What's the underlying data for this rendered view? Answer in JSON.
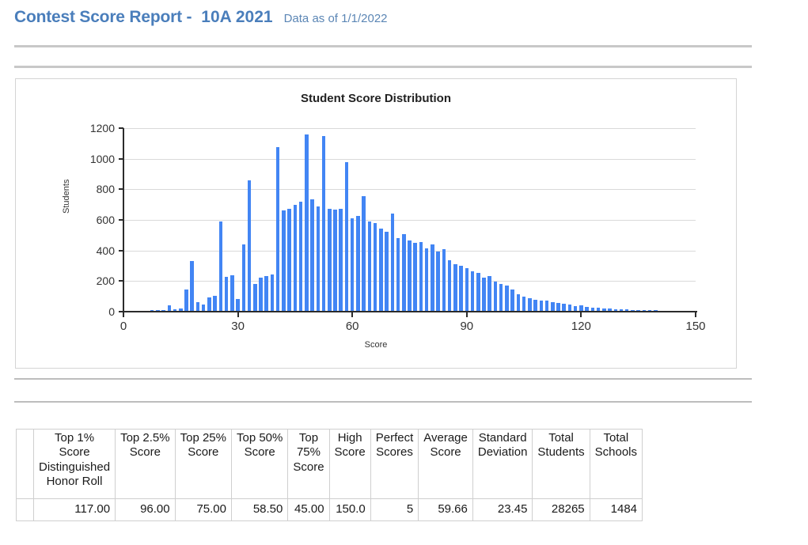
{
  "header": {
    "title": "Contest Score Report -",
    "contest": "10A 2021",
    "as_of": "Data as of 1/1/2022",
    "title_color": "#4a7ebb",
    "asof_color": "#5b86b5"
  },
  "chart_data": {
    "type": "bar",
    "title": "Student Score Distribution",
    "xlabel": "Score",
    "ylabel": "Students",
    "xlim": [
      0,
      150
    ],
    "ylim": [
      0,
      1200
    ],
    "ytick_step": 200,
    "yticks": [
      0,
      200,
      400,
      600,
      800,
      1000,
      1200
    ],
    "xticks": [
      0,
      30,
      60,
      90,
      120,
      150
    ],
    "grid": true,
    "legend": "none",
    "bar_color": "#4285f4",
    "bin_width": 1.5,
    "x": [
      0,
      1.5,
      3,
      4.5,
      6,
      7.5,
      9,
      10.5,
      12,
      13.5,
      15,
      16.5,
      18,
      19.5,
      21,
      22.5,
      24,
      25.5,
      27,
      28.5,
      30,
      31.5,
      33,
      34.5,
      36,
      37.5,
      39,
      40.5,
      42,
      43.5,
      45,
      46.5,
      48,
      49.5,
      51,
      52.5,
      54,
      55.5,
      57,
      58.5,
      60,
      61.5,
      63,
      64.5,
      66,
      67.5,
      69,
      70.5,
      72,
      73.5,
      75,
      76.5,
      78,
      79.5,
      81,
      82.5,
      84,
      85.5,
      87,
      88.5,
      90,
      91.5,
      93,
      94.5,
      96,
      97.5,
      99,
      100.5,
      102,
      103.5,
      105,
      106.5,
      108,
      109.5,
      111,
      112.5,
      114,
      115.5,
      117,
      118.5,
      120,
      121.5,
      123,
      124.5,
      126,
      127.5,
      129,
      130.5,
      132,
      133.5,
      135,
      136.5,
      138,
      139.5,
      141,
      142.5,
      144,
      145.5,
      147,
      148.5,
      150
    ],
    "values": [
      2,
      4,
      3,
      5,
      6,
      8,
      10,
      12,
      40,
      18,
      22,
      145,
      330,
      60,
      45,
      95,
      105,
      590,
      230,
      240,
      85,
      440,
      860,
      180,
      220,
      235,
      245,
      1075,
      660,
      675,
      700,
      720,
      1160,
      735,
      690,
      1150,
      670,
      665,
      675,
      980,
      610,
      625,
      755,
      590,
      580,
      545,
      520,
      640,
      480,
      505,
      465,
      450,
      455,
      415,
      440,
      395,
      410,
      335,
      310,
      300,
      285,
      265,
      255,
      225,
      235,
      195,
      180,
      170,
      145,
      115,
      100,
      90,
      80,
      75,
      70,
      60,
      55,
      50,
      45,
      38,
      40,
      30,
      28,
      25,
      22,
      20,
      18,
      16,
      15,
      13,
      12,
      10,
      9,
      8,
      7,
      6,
      5,
      4,
      3,
      5
    ]
  },
  "table": {
    "headers": [
      "Top 1% Score Distinguished Honor Roll",
      "Top 2.5% Score",
      "Top 25% Score",
      "Top 50% Score",
      "Top 75% Score",
      "High Score",
      "Perfect Scores",
      "Average Score",
      "Standard Deviation",
      "Total Students",
      "Total Schools"
    ],
    "header_lines": [
      [
        "Top 1%",
        "Score",
        "Distinguished",
        "Honor Roll"
      ],
      [
        "Top 2.5%",
        "Score"
      ],
      [
        "Top 25%",
        "Score"
      ],
      [
        "Top 50%",
        "Score"
      ],
      [
        "Top",
        "75%",
        "Score"
      ],
      [
        "High",
        "Score"
      ],
      [
        "Perfect",
        "Scores"
      ],
      [
        "Average",
        "Score"
      ],
      [
        "Standard",
        "Deviation"
      ],
      [
        "Total",
        "Students"
      ],
      [
        "Total",
        "Schools"
      ]
    ],
    "values": [
      "117.00",
      "96.00",
      "75.00",
      "58.50",
      "45.00",
      "150.0",
      "5",
      "59.66",
      "23.45",
      "28265",
      "1484"
    ]
  }
}
